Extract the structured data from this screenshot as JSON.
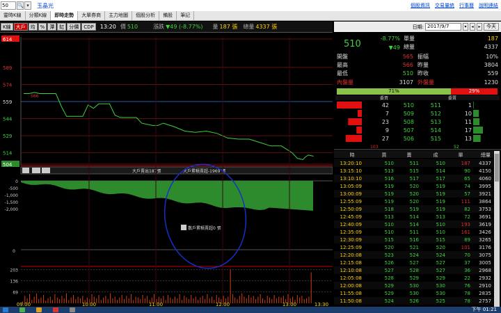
{
  "topbar": {
    "stock_code": "50",
    "stock_name": "玉晶光",
    "links": [
      "個股資訊",
      "交易量統",
      "行事曆",
      "說明連結"
    ]
  },
  "tabs": [
    "靈時K線",
    "分類K線",
    "即時走勢",
    "大單券商",
    "主力地圖",
    "個股分析",
    "備股",
    "筆記"
  ],
  "active_tab": 2,
  "toolbar": {
    "buttons": [
      "K線",
      "大戶",
      "均",
      "%",
      "潭",
      "缸",
      "分價",
      "CDP"
    ],
    "time": "13:20",
    "price_label": "價",
    "price": "510",
    "change_label": "漲跌",
    "change": "▼49 (-8.77%)",
    "volume_label": "量",
    "volume": "187 張",
    "total_label": "總量",
    "total": "4337 張"
  },
  "chart_data": [
    {
      "type": "line",
      "name": "price",
      "x_axis_ticks": [
        "09:00",
        "10:00",
        "11:00",
        "12:00",
        "13:00",
        "13:30"
      ],
      "y_ticks": [
        "614",
        "589",
        "574",
        "559",
        "544",
        "529",
        "514",
        "504"
      ],
      "ylim": [
        504,
        614
      ],
      "x": [
        0,
        5,
        10,
        15,
        30,
        35,
        40,
        45,
        55,
        60,
        65,
        70,
        80,
        85,
        90,
        100,
        105,
        110,
        120,
        125,
        130,
        140,
        150,
        160,
        170,
        180,
        190,
        200,
        210,
        220,
        230,
        240,
        250,
        255,
        260,
        262,
        265,
        270
      ],
      "y": [
        566,
        566,
        567,
        566,
        566,
        555,
        546,
        546,
        546,
        556,
        553,
        557,
        557,
        547,
        545,
        545,
        545,
        540,
        538,
        538,
        540,
        537,
        533,
        532,
        533,
        531,
        527,
        526,
        526,
        523,
        520,
        520,
        514,
        509,
        508,
        510,
        512,
        511
      ],
      "annotations": [
        "566",
        "510"
      ],
      "ref_line": 559
    },
    {
      "type": "area",
      "name": "big-player",
      "y_ticks": [
        "0",
        "-500",
        "-1,000",
        "-1,500",
        "-2,000"
      ],
      "labels": [
        "大戶賣出187張",
        "大戶累積賣超-1969 張",
        "散戶累積賣超0 張"
      ]
    },
    {
      "type": "bar",
      "name": "volume",
      "y_ticks": [
        "203",
        "136",
        "69"
      ],
      "values": [
        10,
        45,
        30,
        55,
        20,
        40,
        60,
        25,
        35,
        50,
        15,
        30,
        40,
        20,
        55,
        35,
        25,
        45,
        30,
        60,
        20,
        35,
        50,
        25,
        40,
        30,
        45,
        20,
        35,
        25,
        55,
        40,
        30,
        50,
        20,
        35,
        45,
        25,
        60,
        30,
        40,
        20,
        35,
        50,
        25,
        45,
        30,
        55,
        20,
        40,
        35,
        25,
        50,
        30,
        45,
        20,
        35,
        55,
        25,
        40,
        30,
        45,
        20,
        50,
        35,
        25,
        40,
        30,
        55,
        20,
        45,
        35,
        25,
        50,
        30,
        40,
        20,
        35,
        45,
        25,
        55,
        30,
        40,
        20,
        50,
        35,
        25,
        45,
        30,
        40,
        203,
        55,
        35,
        25,
        45,
        60,
        40,
        30,
        50,
        35,
        45,
        25,
        40,
        55,
        30,
        20,
        45,
        35,
        25,
        50,
        30,
        40,
        35,
        45,
        25,
        55,
        30,
        40,
        20,
        50,
        35,
        45,
        25,
        30,
        40,
        187
      ]
    }
  ],
  "datebar": {
    "label": "日期:",
    "date": "2017/9/7",
    "today": "今天"
  },
  "quote": {
    "price": "510",
    "pct": "-8.77%",
    "change": "▼49",
    "rows": [
      {
        "l1": "單量",
        "v1": "187",
        "l2": "",
        "v2": ""
      },
      {
        "l1": "總量",
        "v1": "4337",
        "l2": "",
        "v2": ""
      },
      {
        "l0": "開盤",
        "v0": "565",
        "l1": "振幅",
        "v1": "10%"
      },
      {
        "l0": "最高",
        "v0": "566",
        "l1": "昨量",
        "v1": "3804"
      },
      {
        "l0": "最低",
        "v0": "510",
        "l1": "昨收",
        "v1": "559"
      },
      {
        "l0": "內盤量",
        "v0": "3107",
        "l1": "外盤量",
        "v1": "1230"
      }
    ]
  },
  "ratio": {
    "buy": "71%",
    "sell": "29%",
    "buy_frac": 0.71
  },
  "depth": {
    "header": [
      "委買",
      "委賣"
    ],
    "rows": [
      {
        "bv": "42",
        "bp": "510",
        "sp": "511",
        "sv": "1"
      },
      {
        "bv": "7",
        "bp": "509",
        "sp": "512",
        "sv": "10"
      },
      {
        "bv": "23",
        "bp": "508",
        "sp": "513",
        "sv": "11"
      },
      {
        "bv": "9",
        "bp": "507",
        "sp": "514",
        "sv": "17"
      },
      {
        "bv": "27",
        "bp": "506",
        "sp": "515",
        "sv": "13"
      }
    ],
    "totals": [
      "103",
      "52"
    ]
  },
  "ticks": {
    "header": [
      "時",
      "買",
      "賣",
      "成",
      "單",
      "總量"
    ],
    "rows": [
      [
        "13:20:10",
        "510",
        "511",
        "510",
        "187",
        "4337"
      ],
      [
        "13:15:10",
        "513",
        "515",
        "514",
        "90",
        "4150"
      ],
      [
        "13:10:10",
        "516",
        "517",
        "517",
        "65",
        "4060"
      ],
      [
        "13:05:09",
        "519",
        "520",
        "519",
        "74",
        "3995"
      ],
      [
        "13:00:09",
        "519",
        "520",
        "519",
        "57",
        "3921"
      ],
      [
        "12:55:09",
        "519",
        "520",
        "519",
        "111",
        "3864"
      ],
      [
        "12:50:09",
        "518",
        "519",
        "519",
        "82",
        "3753"
      ],
      [
        "12:45:09",
        "513",
        "514",
        "513",
        "72",
        "3691"
      ],
      [
        "12:40:09",
        "510",
        "514",
        "510",
        "193",
        "3619"
      ],
      [
        "12:35:09",
        "510",
        "511",
        "510",
        "161",
        "3426"
      ],
      [
        "12:30:09",
        "515",
        "516",
        "515",
        "89",
        "3265"
      ],
      [
        "12:25:09",
        "520",
        "521",
        "520",
        "101",
        "3176"
      ],
      [
        "12:20:08",
        "523",
        "524",
        "524",
        "70",
        "3075"
      ],
      [
        "12:15:08",
        "526",
        "527",
        "527",
        "37",
        "3005"
      ],
      [
        "12:10:08",
        "527",
        "528",
        "527",
        "36",
        "2968"
      ],
      [
        "12:05:08",
        "528",
        "529",
        "529",
        "22",
        "2932"
      ],
      [
        "12:00:08",
        "529",
        "530",
        "530",
        "76",
        "2910"
      ],
      [
        "11:55:08",
        "529",
        "530",
        "530",
        "78",
        "2835"
      ],
      [
        "11:50:08",
        "524",
        "526",
        "525",
        "78",
        "2757"
      ]
    ]
  },
  "taskbar": {
    "clock": "下午 01:21"
  }
}
